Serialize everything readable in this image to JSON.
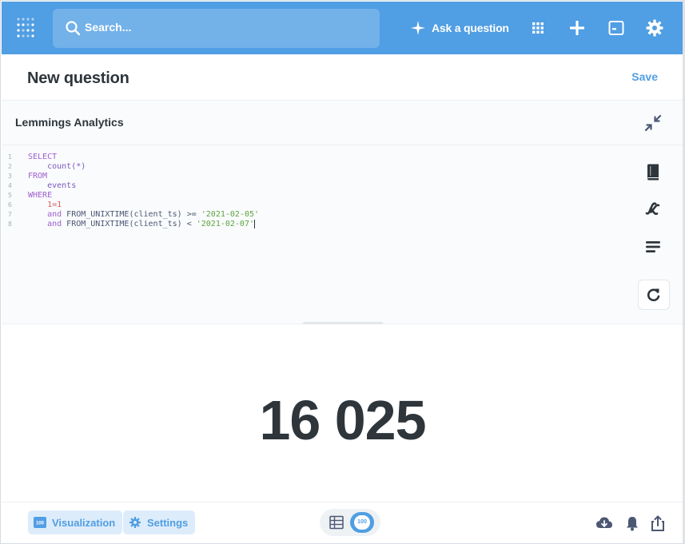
{
  "nav": {
    "search_placeholder": "Search...",
    "ask_label": "Ask a question",
    "icons": [
      "metabase-logo-icon",
      "search-icon",
      "sparkle-icon",
      "grid-icon",
      "plus-icon",
      "sql-editor-icon",
      "gear-icon"
    ]
  },
  "header": {
    "title": "New question",
    "save_label": "Save"
  },
  "editor": {
    "database": "Lemmings Analytics",
    "lines": [
      {
        "n": "1",
        "tokens": [
          {
            "t": "kw",
            "v": "SELECT"
          }
        ]
      },
      {
        "n": "2",
        "tokens": [
          {
            "t": "plain",
            "v": "    "
          },
          {
            "t": "id",
            "v": "count(*)"
          }
        ]
      },
      {
        "n": "3",
        "tokens": [
          {
            "t": "kw",
            "v": "FROM"
          }
        ]
      },
      {
        "n": "4",
        "tokens": [
          {
            "t": "plain",
            "v": "    "
          },
          {
            "t": "id",
            "v": "events"
          }
        ]
      },
      {
        "n": "5",
        "tokens": [
          {
            "t": "kw",
            "v": "WHERE"
          }
        ]
      },
      {
        "n": "6",
        "tokens": [
          {
            "t": "plain",
            "v": "    "
          },
          {
            "t": "num",
            "v": "1=1"
          }
        ]
      },
      {
        "n": "7",
        "tokens": [
          {
            "t": "plain",
            "v": "    "
          },
          {
            "t": "kw",
            "v": "and"
          },
          {
            "t": "plain",
            "v": " FROM_UNIXTIME(client_ts) >= "
          },
          {
            "t": "str",
            "v": "'2021-02-05'"
          }
        ]
      },
      {
        "n": "8",
        "tokens": [
          {
            "t": "plain",
            "v": "    "
          },
          {
            "t": "kw",
            "v": "and"
          },
          {
            "t": "plain",
            "v": " FROM_UNIXTIME(client_ts) < "
          },
          {
            "t": "str",
            "v": "'2021-02-07'"
          }
        ]
      }
    ]
  },
  "result": {
    "value": "16 025"
  },
  "footer": {
    "visualization_label": "Visualization",
    "settings_label": "Settings",
    "badge_label": "100"
  },
  "colors": {
    "brand": "#509ee3",
    "text": "#2e353b"
  }
}
